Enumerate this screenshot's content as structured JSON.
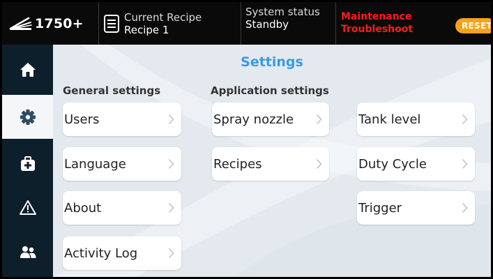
{
  "header": {
    "brand_label": "1750+",
    "recipe_title": "Current Recipe",
    "recipe_value": "Recipe 1",
    "status_title": "System status",
    "status_value": "Standby",
    "alert_maintenance": "Maintenance",
    "alert_troubleshoot": "Troubleshoot",
    "reset_label": "RESET",
    "alert_color": "#ff1a1a",
    "reset_color": "#f7a21b"
  },
  "sidebar": {
    "items": [
      {
        "icon": "home-icon",
        "active": false
      },
      {
        "icon": "gear-icon",
        "active": true
      },
      {
        "icon": "first-aid-kit-icon",
        "active": false
      },
      {
        "icon": "warning-icon",
        "active": false
      },
      {
        "icon": "users-icon",
        "active": false
      }
    ]
  },
  "main": {
    "title": "Settings",
    "title_color": "#3a9be0",
    "general_heading": "General settings",
    "application_heading": "Application settings",
    "general_items": [
      "Users",
      "Language",
      "About",
      "Activity Log"
    ],
    "application_items": [
      "Spray nozzle",
      "Recipes"
    ],
    "application_items_col2": [
      "Tank level",
      "Duty Cycle",
      "Trigger"
    ]
  }
}
